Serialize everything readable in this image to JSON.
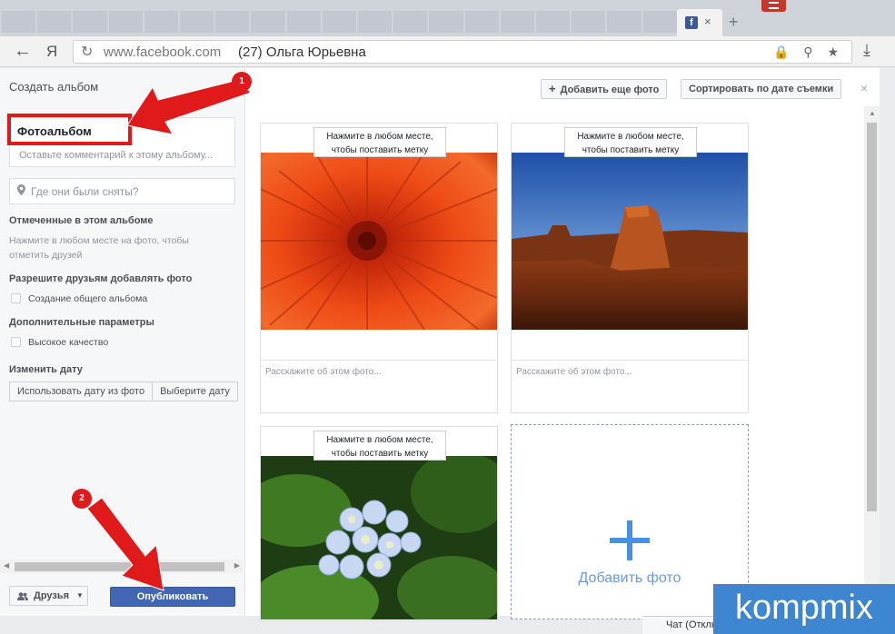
{
  "browser": {
    "back_glyph": "←",
    "yandex_glyph": "Я",
    "reload_glyph": "↻",
    "url_host": "www.facebook.com",
    "page_title": "(27) Ольга Юрьевна",
    "tab_favicon": "f",
    "tab_close": "×",
    "new_tab": "+",
    "address_icons": "🔒 ⚲ ★",
    "download_glyph": "⤓"
  },
  "dialog": {
    "title": "Создать альбом",
    "add_more_photos": "Добавить еще фото",
    "sort_by_date": "Сортировать по дате съемки",
    "close": "×",
    "album_name": "Фотоальбом",
    "comment_placeholder": "Оставьте комментарий к этому альбому...",
    "location_placeholder": "Где они были сняты?",
    "tagged_title": "Отмеченные в этом альбоме",
    "tagged_hint": "Нажмите в любом месте на фото, чтобы отметить друзей",
    "allow_friends_title": "Разрешите друзьям добавлять фото",
    "shared_album_label": "Создание общего альбома",
    "extra_params_title": "Дополнительные параметры",
    "high_quality_label": "Высокое качество",
    "change_date_title": "Изменить дату",
    "use_photo_date": "Использовать дату из фото",
    "choose_date": "Выберите дату",
    "audience": "Друзья",
    "publish": "Опубликовать"
  },
  "photos": [
    {
      "tag_hint": "Нажмите в любом месте, чтобы поставить метку",
      "description_placeholder": "Расскажите об этом фото...",
      "subject": "red-flower"
    },
    {
      "tag_hint": "Нажмите в любом месте, чтобы поставить метку",
      "description_placeholder": "Расскажите об этом фото...",
      "subject": "desert-mesa"
    },
    {
      "tag_hint": "Нажмите в любом месте, чтобы поставить метку",
      "subject": "hydrangea"
    }
  ],
  "add_photo_label": "Добавить фото",
  "chat_bar": "Чат (Отключен",
  "watermark": "kompmix",
  "badges": [
    "1",
    "2"
  ],
  "colors": {
    "publish_bg": "#4267b2",
    "annotation_red": "#e0191b",
    "watermark_bg": "#3e86d0"
  }
}
